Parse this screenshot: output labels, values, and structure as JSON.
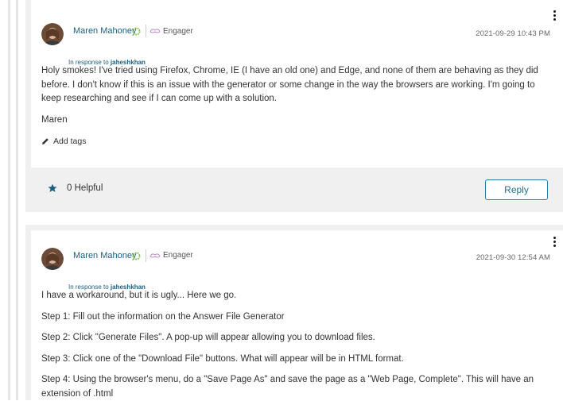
{
  "posts": [
    {
      "author": "Maren Mahoney",
      "rank": "Engager",
      "timestamp": "2021-09-29 10:43 PM",
      "in_response_prefix": "In response to ",
      "in_response_to": "jaheshkhan",
      "paragraphs": [
        "Holy smokes! I've tried using Firefox, Chrome, IE (I have an old one) and Edge, and none of them are behaving as they did before. I don't know if this is an issue with the generator or some change in the way the browsers are working. I'm going to keep researching and see if I can come up with a solution.",
        "Maren"
      ],
      "add_tags": "Add tags",
      "helpful_count": "0 Helpful",
      "reply": "Reply"
    },
    {
      "author": "Maren Mahoney",
      "rank": "Engager",
      "timestamp": "2021-09-30 12:54 AM",
      "in_response_prefix": "In response to ",
      "in_response_to": "jaheshkhan",
      "paragraphs": [
        "I have a workaround, but it is ugly... Here we go.",
        "Step 1: Fill out the information on the Answer File Generator",
        "Step 2: Click \"Generate Files\". A pop-up will appear allowing you to download files.",
        "Step 3: Click one of the \"Download File\" buttons. What will appear will be in HTML format.",
        "Step 4: Using the browser's menu, do a \"Save Page As\" and save the page as a \"Web Page, Complete\". This will have an extension of .html"
      ]
    }
  ],
  "icons": {
    "kebab": "more-options-icon",
    "rank": "engager-rank-icon",
    "ring": "rank-progress-icon",
    "pencil": "pencil-icon",
    "star": "star-icon"
  },
  "colors": {
    "link": "#1a5e80",
    "reply_border": "#1e7fa8",
    "card_bg": "#f0f0f0"
  }
}
